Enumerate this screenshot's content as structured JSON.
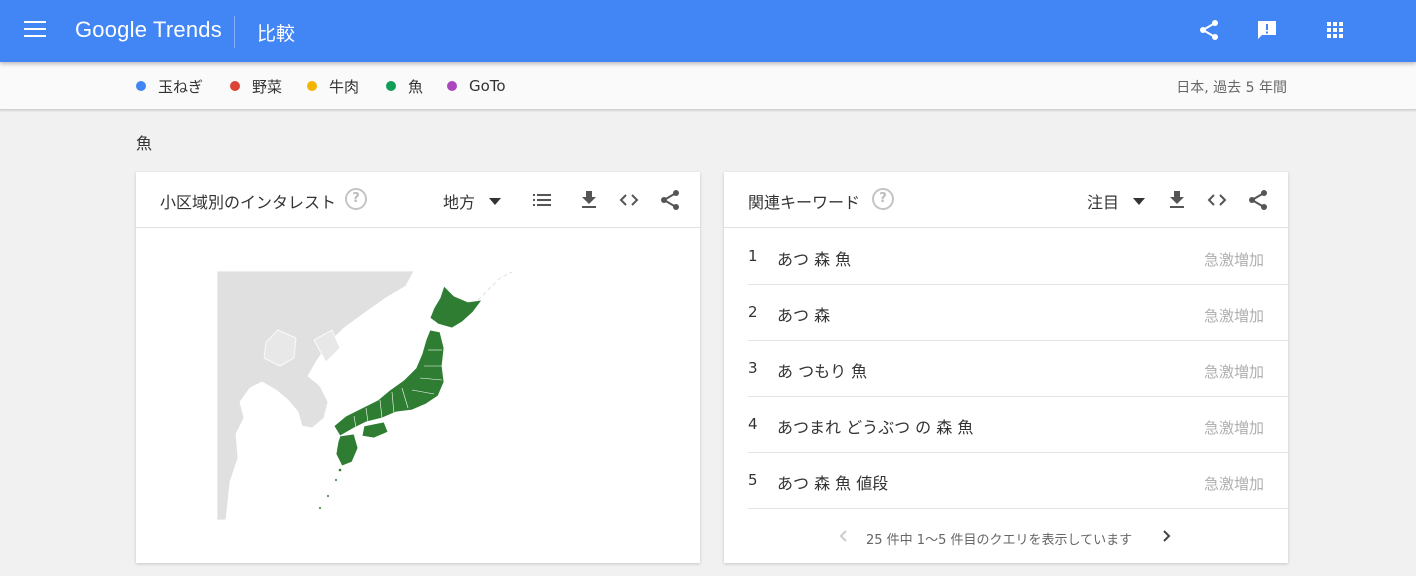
{
  "header": {
    "logo_text": "Google Trends",
    "title": "比較",
    "icons": [
      "menu-icon",
      "share-icon",
      "feedback-icon",
      "apps-grid-icon"
    ],
    "bg_color": "#4285f4"
  },
  "compare": {
    "terms": [
      {
        "label": "玉ねぎ",
        "color": "#4285f4"
      },
      {
        "label": "野菜",
        "color": "#db4437"
      },
      {
        "label": "牛肉",
        "color": "#f4b400"
      },
      {
        "label": "魚",
        "color": "#0f9d58"
      },
      {
        "label": "GoTo",
        "color": "#ab47bc"
      }
    ],
    "region_info": "日本, 過去 5 年間"
  },
  "section_label": "魚",
  "interest_card": {
    "title": "小区域別のインタレスト",
    "help": "?",
    "dropdown": "地方",
    "tools": [
      "list-icon",
      "download-icon",
      "embed-icon",
      "share-icon"
    ],
    "map": {
      "region": "Japan",
      "fill_color": "#2e7d32",
      "land_color": "#e0e0e0"
    }
  },
  "related_card": {
    "title": "関連キーワード",
    "help": "?",
    "dropdown": "注目",
    "tools": [
      "download-icon",
      "embed-icon",
      "share-icon"
    ],
    "rows": [
      {
        "idx": "1",
        "keyword": "あつ 森 魚",
        "value": "急激増加"
      },
      {
        "idx": "2",
        "keyword": "あつ 森",
        "value": "急激増加"
      },
      {
        "idx": "3",
        "keyword": "あ つもり 魚",
        "value": "急激増加"
      },
      {
        "idx": "4",
        "keyword": "あつまれ どうぶつ の 森 魚",
        "value": "急激増加"
      },
      {
        "idx": "5",
        "keyword": "あつ 森 魚 値段",
        "value": "急激増加"
      }
    ],
    "pagination": "25 件中 1～5 件目のクエリを表示しています"
  }
}
